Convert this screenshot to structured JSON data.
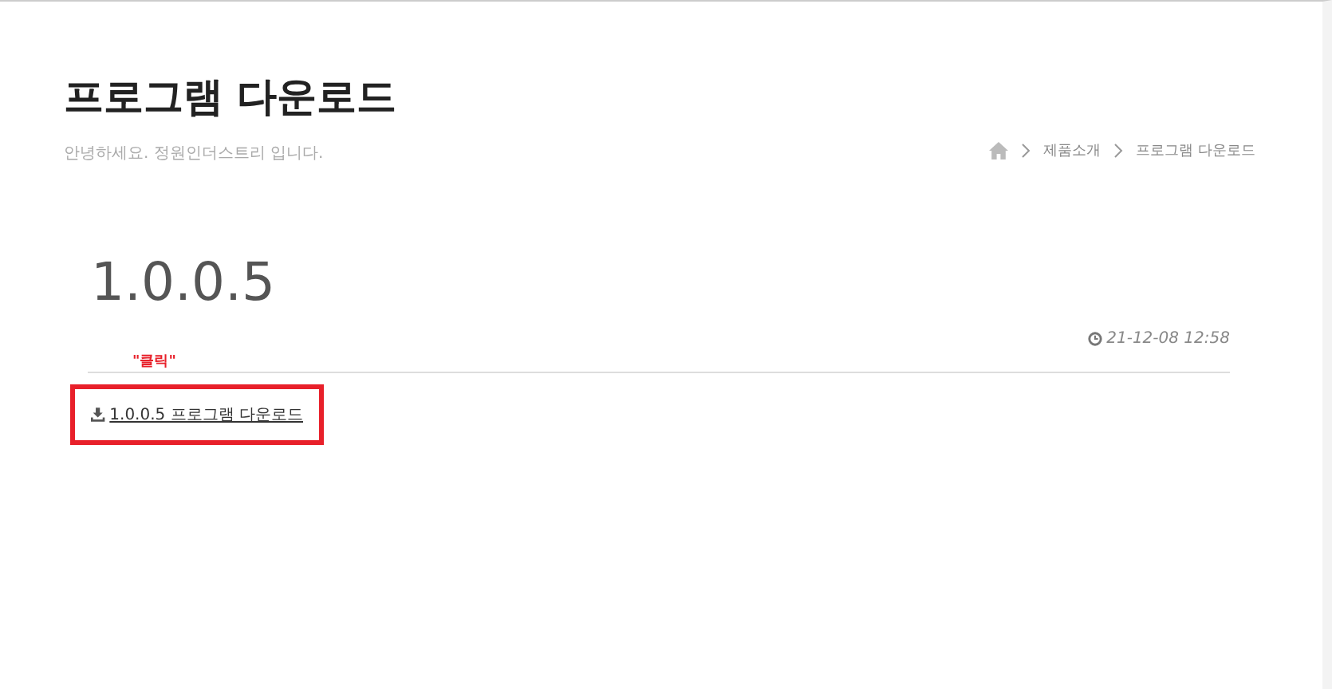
{
  "header": {
    "title": "프로그램 다운로드",
    "subtitle": "안녕하세요. 정원인더스트리 입니다."
  },
  "breadcrumb": [
    "제품소개",
    "프로그램 다운로드"
  ],
  "post": {
    "title": "1.0.0.5",
    "date": "21-12-08 12:58"
  },
  "annotation": {
    "label": "\"클릭\"",
    "highlighted": true
  },
  "download_link": {
    "label": "1.0.0.5 프로그램 다운로드"
  }
}
